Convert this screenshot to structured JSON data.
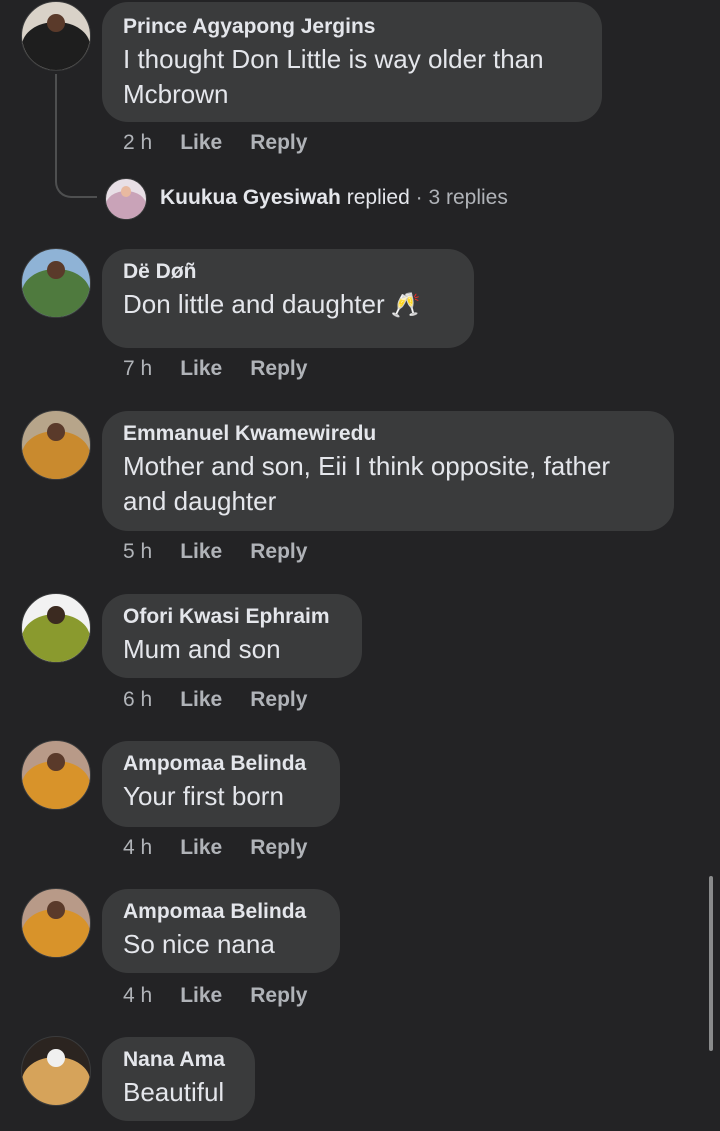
{
  "comments": [
    {
      "author": "Prince Agyapong Jergins",
      "text": "I thought Don Little is way older than Mcbrown",
      "time": "2 h",
      "like": "Like",
      "reply": "Reply",
      "replies_summary": {
        "name": "Kuukua Gyesiwah",
        "verb": "replied",
        "dot": "·",
        "count": "3 replies"
      }
    },
    {
      "author": "Dë Døñ",
      "text": "Don little and daughter",
      "emoji": "🥂",
      "time": "7 h",
      "like": "Like",
      "reply": "Reply"
    },
    {
      "author": "Emmanuel Kwamewiredu",
      "text": "Mother and son, Eii I think opposite, father and daughter",
      "time": "5 h",
      "like": "Like",
      "reply": "Reply"
    },
    {
      "author": "Ofori Kwasi Ephraim",
      "text": "Mum and son",
      "time": "6 h",
      "like": "Like",
      "reply": "Reply"
    },
    {
      "author": "Ampomaa Belinda",
      "text": "Your first born",
      "time": "4 h",
      "like": "Like",
      "reply": "Reply"
    },
    {
      "author": "Ampomaa Belinda",
      "text": "So nice nana",
      "time": "4 h",
      "like": "Like",
      "reply": "Reply"
    },
    {
      "author": "Nana Ama",
      "text": "Beautiful"
    }
  ],
  "colors": {
    "background": "#232325",
    "bubble": "#3a3b3c",
    "primary_text": "#e4e6eb",
    "secondary_text": "#b0b3b8"
  }
}
